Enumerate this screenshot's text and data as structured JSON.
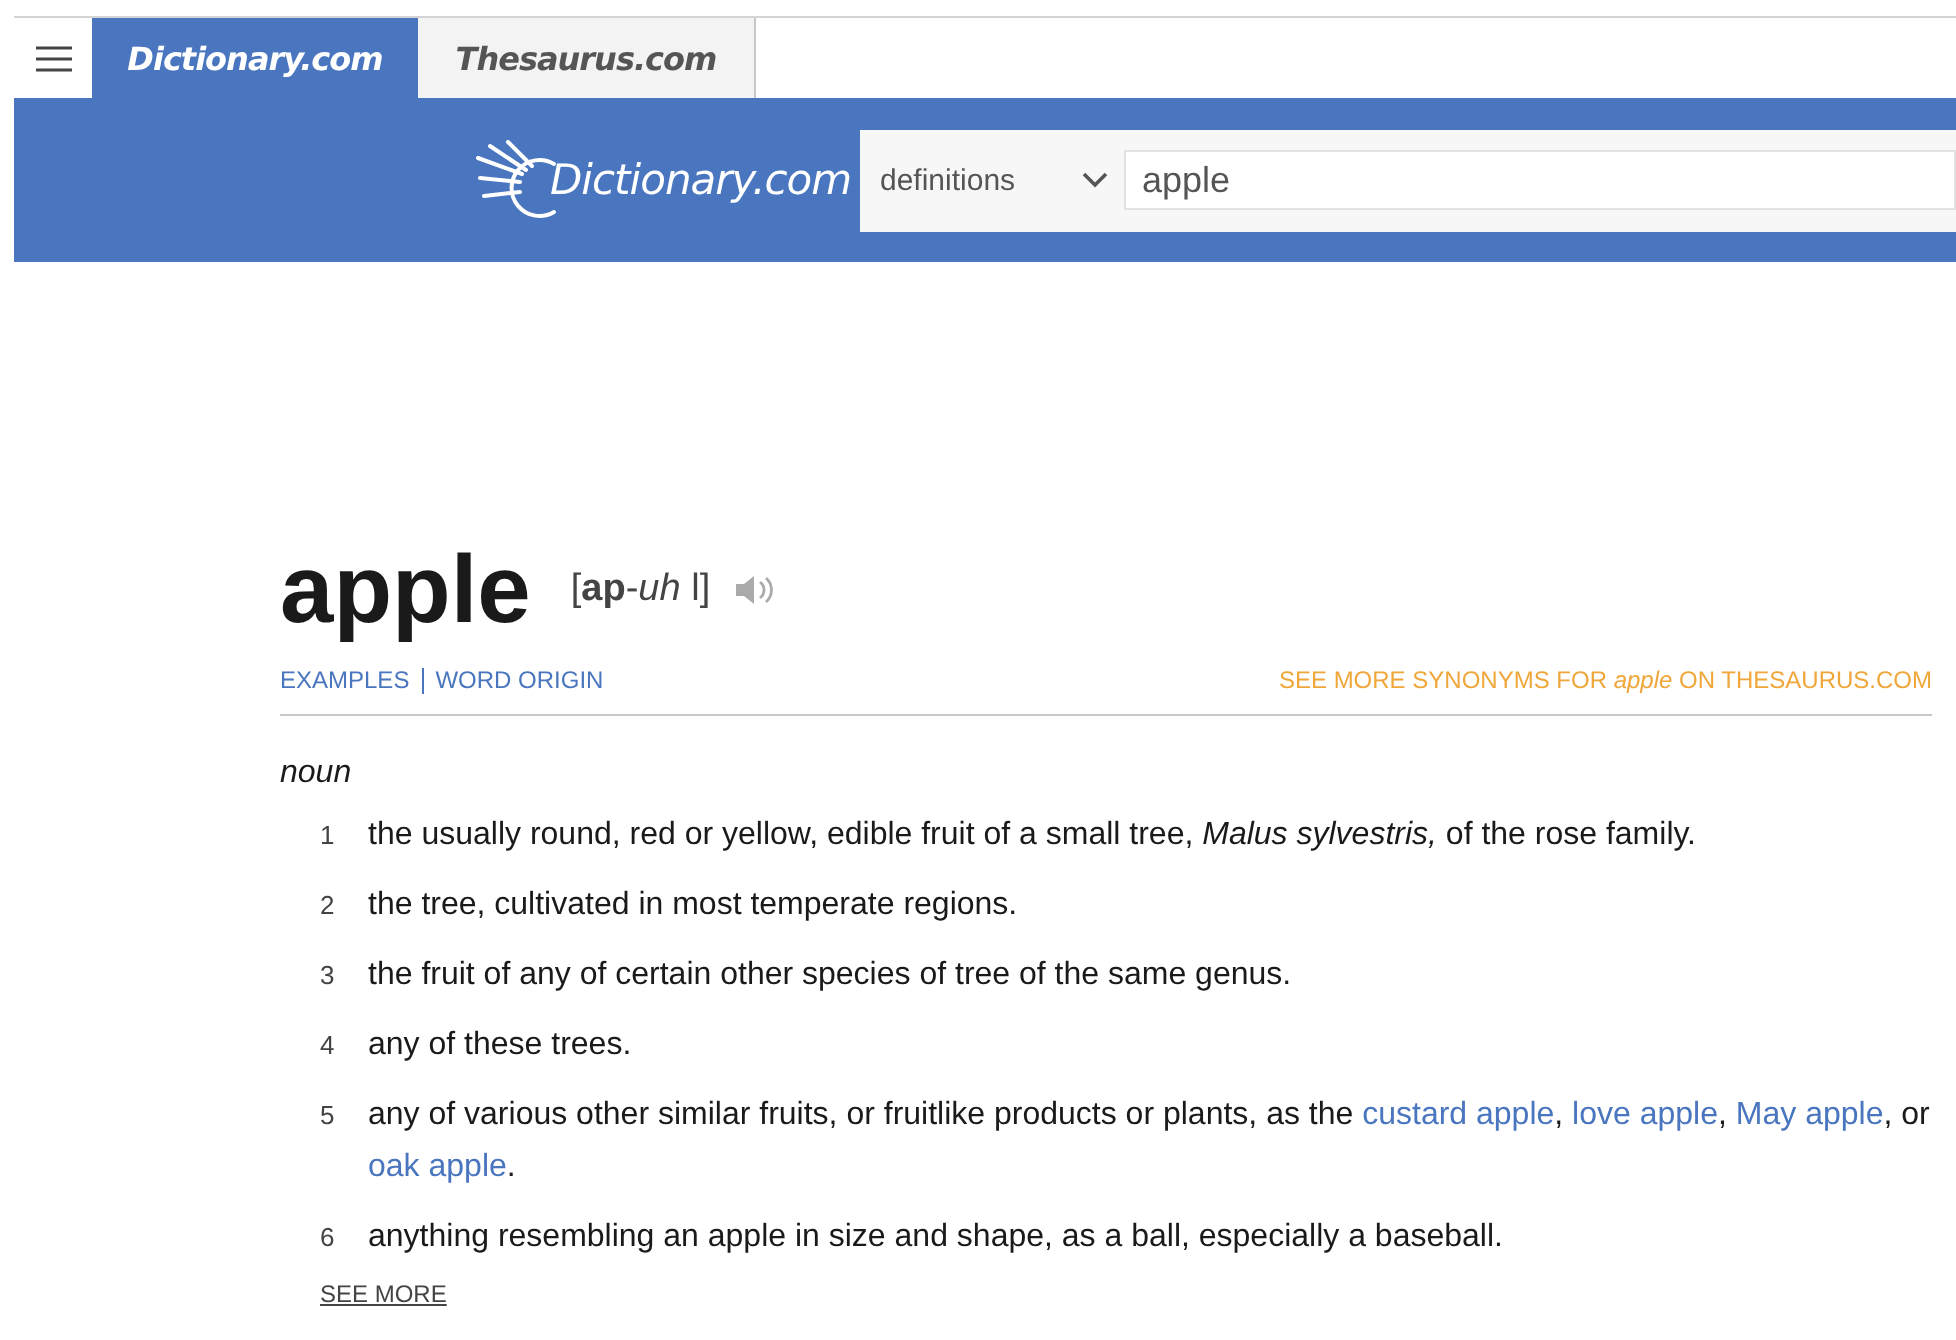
{
  "tabs": [
    {
      "label": "Dictionary.com",
      "selected": true
    },
    {
      "label": "Thesaurus.com",
      "selected": false
    }
  ],
  "logo": {
    "text": "Dictionary.com"
  },
  "search": {
    "category": "definitions",
    "value": "apple"
  },
  "entry": {
    "word": "apple",
    "pronunciation": "[**ap**-*uh* l]",
    "links": [
      "EXAMPLES",
      "WORD ORIGIN"
    ],
    "synonyms_link": "SEE MORE SYNONYMS FOR *apple* ON THESAURUS.COM",
    "part_of_speech": "noun",
    "definitions": [
      {
        "number": "1",
        "parts": [
          {
            "kind": "text",
            "text": "the usually round, red or yellow, edible fruit of a small tree, *Malus sylvestris,* of the rose family."
          }
        ]
      },
      {
        "number": "2",
        "parts": [
          {
            "kind": "text",
            "text": "the tree, cultivated in most temperate regions."
          }
        ]
      },
      {
        "number": "3",
        "parts": [
          {
            "kind": "text",
            "text": "the fruit of any of certain other species of tree of the same genus."
          }
        ]
      },
      {
        "number": "4",
        "parts": [
          {
            "kind": "text",
            "text": "any of these trees."
          }
        ]
      },
      {
        "number": "5",
        "parts": [
          {
            "kind": "text",
            "text": "any of various other similar fruits, or fruitlike products or plants, as the "
          },
          {
            "kind": "link",
            "text": "custard apple"
          },
          {
            "kind": "text",
            "text": ", "
          },
          {
            "kind": "link",
            "text": "love apple"
          },
          {
            "kind": "text",
            "text": ", "
          },
          {
            "kind": "link",
            "text": "May apple"
          },
          {
            "kind": "text",
            "text": ", or "
          },
          {
            "kind": "link",
            "text": "oak apple"
          },
          {
            "kind": "text",
            "text": "."
          }
        ]
      },
      {
        "number": "6",
        "parts": [
          {
            "kind": "text",
            "text": "anything resembling an apple in size and shape, as a ball, especially a baseball."
          }
        ]
      }
    ],
    "see_more": "SEE MORE"
  }
}
